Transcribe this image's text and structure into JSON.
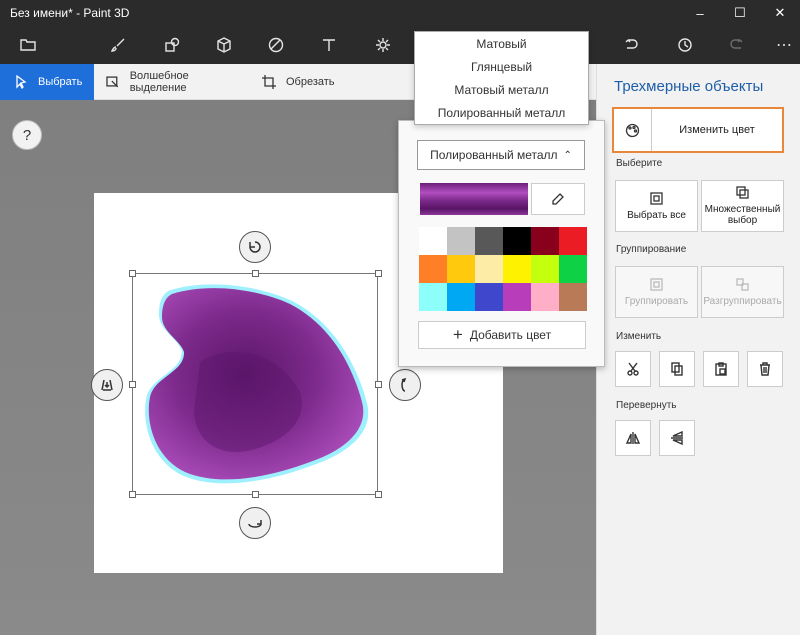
{
  "window": {
    "title": "Без имени* - Paint 3D"
  },
  "toolbar": {
    "icons": [
      "folder-icon",
      "brush-icon",
      "shapes-2d-icon",
      "cube-3d-icon",
      "sticker-icon",
      "text-icon",
      "effects-icon",
      "undo-icon",
      "history-icon",
      "redo-icon",
      "more-icon"
    ]
  },
  "subbar": {
    "select": "Выбрать",
    "magic_select": "Волшебное выделение",
    "crop": "Обрезать"
  },
  "canvas": {
    "help": "?"
  },
  "panel": {
    "title": "Трехмерные объекты",
    "change_color": "Изменить цвет",
    "section_select": "Выберите",
    "select_all": "Выбрать все",
    "multi_select": "Множественный выбор",
    "section_group": "Группирование",
    "group": "Группировать",
    "ungroup": "Разгруппировать",
    "section_edit": "Изменить",
    "section_flip": "Перевернуть"
  },
  "flyout": {
    "finish_selected": "Полированный металл",
    "add_color": "Добавить цвет",
    "palette": [
      "#ffffff",
      "#c3c3c3",
      "#585858",
      "#000000",
      "#88001b",
      "#ec1c24",
      "#ff7f27",
      "#ffc90e",
      "#fdeca6",
      "#fff200",
      "#c4ff0e",
      "#0ed145",
      "#8cfffb",
      "#00a8f3",
      "#3f48cc",
      "#b83dba",
      "#ffaec8",
      "#b97a57"
    ]
  },
  "finish_menu": {
    "items": [
      "Матовый",
      "Глянцевый",
      "Матовый металл",
      "Полированный металл"
    ]
  },
  "colors": {
    "accent": "#1e6fd9",
    "highlight": "#e8873a",
    "selected_color": "#8b3698"
  }
}
